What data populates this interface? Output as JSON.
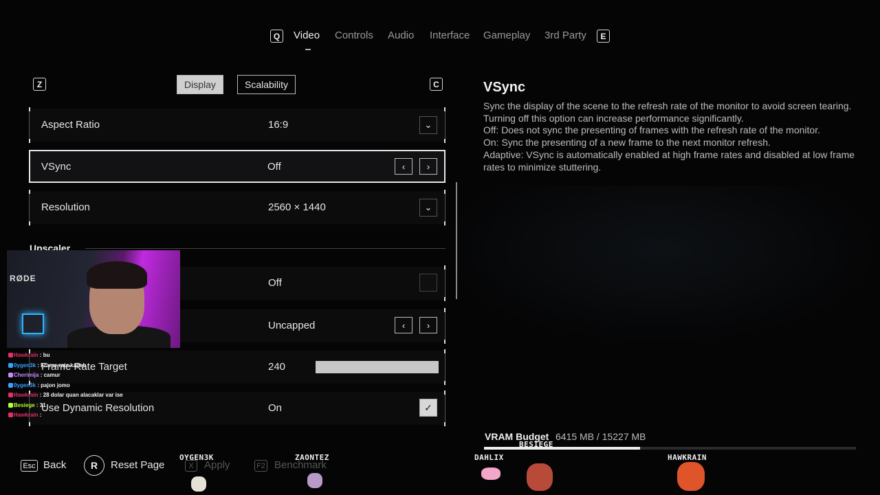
{
  "top_tabs": {
    "left_key": "Q",
    "right_key": "E",
    "items": [
      "Video",
      "Controls",
      "Audio",
      "Interface",
      "Gameplay",
      "3rd Party"
    ],
    "active": "Video"
  },
  "sub_tabs": {
    "left_key": "Z",
    "right_key": "C",
    "display": "Display",
    "scalability": "Scalability"
  },
  "settings": {
    "aspect_ratio": {
      "label": "Aspect Ratio",
      "value": "16:9"
    },
    "vsync": {
      "label": "VSync",
      "value": "Off"
    },
    "resolution": {
      "label": "Resolution",
      "value": "2560 × 1440"
    },
    "upscaler_section": "Upscaler",
    "hidden_toggle": {
      "value": "Off"
    },
    "frame_rate_limit": {
      "value": "Uncapped"
    },
    "frame_rate_target": {
      "label": "Frame Rate Target",
      "value": "240"
    },
    "dynamic_resolution": {
      "label": "Use Dynamic Resolution",
      "value": "On"
    }
  },
  "description": {
    "title": "VSync",
    "lines": [
      "Sync the display of the scene to the refresh rate of the monitor to avoid screen tearing. Turning off this option can increase performance significantly.",
      "Off: Does not sync the presenting of frames  with the refresh rate of the monitor.",
      "On: Sync the presenting of a new frame to the next monitor refresh.",
      "Adaptive: VSync is automatically enabled at high frame rates and disabled at low frame rates to minimize stuttering."
    ]
  },
  "vram": {
    "label": "VRAM Budget",
    "value": "6415 MB / 15227 MB",
    "usage_fraction": 0.42
  },
  "footer": {
    "back_key": "Esc",
    "back_label": "Back",
    "reset_key": "R",
    "reset_label": "Reset Page",
    "apply_key": "X",
    "apply_label": "Apply",
    "bench_key": "F2",
    "bench_label": "Benchmark"
  },
  "overlay": {
    "mic_brand": "RØDE",
    "chat": [
      {
        "user": "Hawkrain",
        "msg": "bu",
        "color": "#e0306a"
      },
      {
        "user": "0ygen3k",
        "msg": "Frame rate kapalı",
        "color": "#3aa0ff"
      },
      {
        "user": "Cherimija",
        "msg": "camur",
        "color": "#c78bff"
      },
      {
        "user": "0ygen3k",
        "msg": "pajon jomo",
        "color": "#3aa0ff"
      },
      {
        "user": "Hawkrain",
        "msg": "28 dolar quan alacaklar var ise",
        "color": "#e0306a"
      },
      {
        "user": "Besiege",
        "msg": "31",
        "color": "#b6ff3a"
      },
      {
        "user": "Hawkrain",
        "msg": "",
        "color": "#e0306a"
      }
    ],
    "players": [
      "OYGEN3K",
      "ZAONTEZ",
      "DAHLIX",
      "HAWKRAIN",
      "BESIEGE"
    ]
  }
}
